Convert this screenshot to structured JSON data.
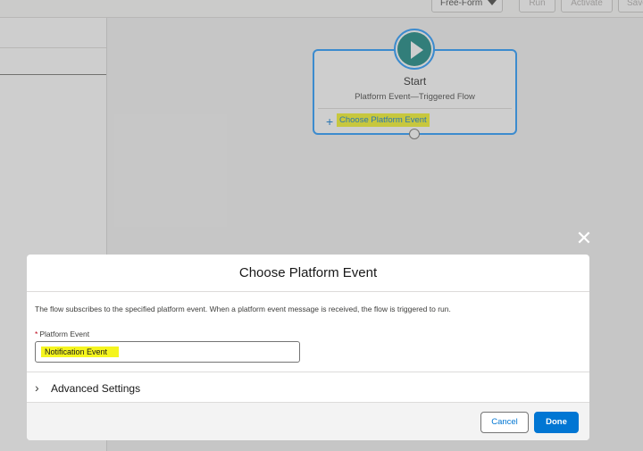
{
  "toolbar": {
    "layout_select": "Free-Form",
    "run_label": "Run",
    "activate_label": "Activate",
    "save_label": "Save"
  },
  "flow": {
    "start_title": "Start",
    "start_subtitle": "Platform Event—Triggered Flow",
    "choose_event_link": "Choose Platform Event"
  },
  "modal": {
    "title": "Choose Platform Event",
    "description": "The flow subscribes to the specified platform event. When a platform event message is received, the flow is triggered to run.",
    "field_required_mark": "*",
    "field_label": "Platform Event",
    "field_value": "Notification Event",
    "advanced_label": "Advanced Settings",
    "cancel_label": "Cancel",
    "done_label": "Done",
    "close_icon": "close-icon"
  },
  "colors": {
    "brand_blue": "#0176d3",
    "start_icon_teal": "#0b827c",
    "highlight_yellow": "#f5f51e",
    "selection_blue": "#1b96ff"
  }
}
